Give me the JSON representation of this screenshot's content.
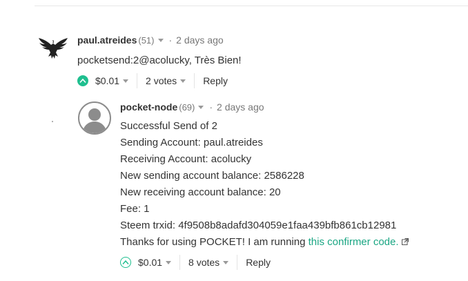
{
  "comments": [
    {
      "author": "paul.atreides",
      "reputation": "(51)",
      "time_sep": "·",
      "time": "2 days ago",
      "body_lines": [
        "pocketsend:2@acolucky, Très Bien!"
      ],
      "payout": "$0.01",
      "votes": "2 votes",
      "reply": "Reply",
      "avatar_icon": "eagle-avatar-icon",
      "vote_style": "filled"
    },
    {
      "author": "pocket-node",
      "reputation": "(69)",
      "time_sep": "·",
      "time": "2 days ago",
      "body_lines": [
        "Successful Send of 2",
        "Sending Account: paul.atreides",
        "Receiving Account: acolucky",
        "New sending account balance: 2586228",
        "New receiving account balance: 20",
        "Fee: 1",
        "Steem trxid: 4f9508b8adafd304059e1faa439bfb861cb12981"
      ],
      "last_line_prefix": "Thanks for using POCKET! I am running ",
      "last_line_link": "this confirmer code.",
      "payout": "$0.01",
      "votes": "8 votes",
      "reply": "Reply",
      "avatar_icon": "default-user-avatar-icon",
      "vote_style": "outline"
    }
  ],
  "colors": {
    "accent": "#1fbf8f",
    "link": "#1aa683",
    "muted": "#777777"
  }
}
